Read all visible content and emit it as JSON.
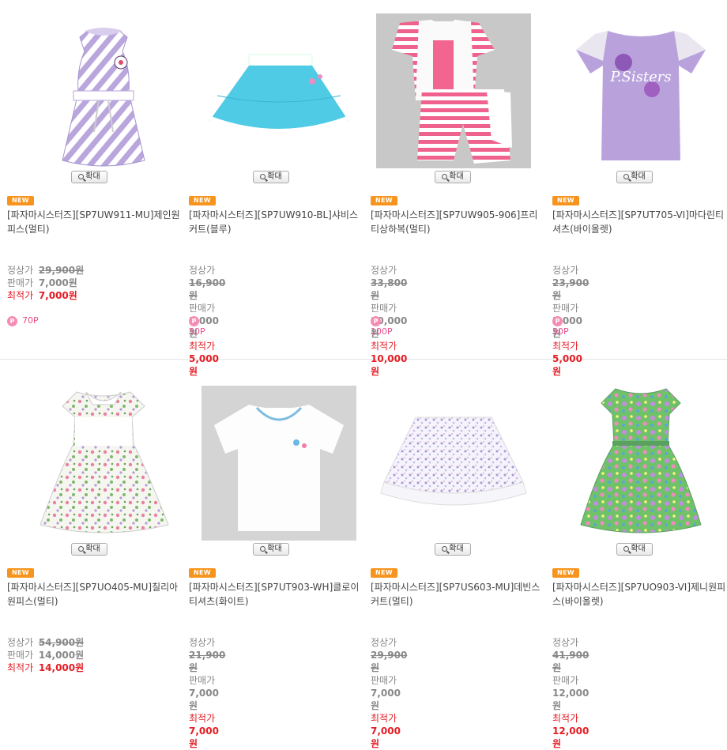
{
  "zoom_label": "확대",
  "new_label": "NEW",
  "price_labels": {
    "original": "정상가",
    "sale": "판매가",
    "best": "최적가"
  },
  "colors": {
    "best_price": "#e41c24",
    "point": "#e84c8b",
    "new_badge": "#f7941d"
  },
  "products": [
    {
      "name": "[파자마시스터즈][SP7UW911-MU]제인원피스(멀티)",
      "original": "29,900원",
      "sale": "7,000원",
      "best": "7,000원",
      "points": "70P",
      "image": "purple-striped-dress"
    },
    {
      "name": "[파자마시스터즈][SP7UW910-BL]샤비스커트(블루)",
      "original": "16,900원",
      "sale": "5,000원",
      "best": "5,000원",
      "points": "50P",
      "image": "blue-skirt"
    },
    {
      "name": "[파자마시스터즈][SP7UW905-906]프리티상하복(멀티)",
      "original": "33,800원",
      "sale": "10,000원",
      "best": "10,000원",
      "points": "100P",
      "image": "pink-striped-set"
    },
    {
      "name": "[파자마시스터즈][SP7UT705-VI]마다린티셔츠(바이올렛)",
      "original": "23,900원",
      "sale": "5,000원",
      "best": "5,000원",
      "points": "50P",
      "image": "violet-tshirt"
    },
    {
      "name": "[파자마시스터즈][SP7UO405-MU]칠리아원피스(멀티)",
      "original": "54,900원",
      "sale": "14,000원",
      "best": "14,000원",
      "points": "",
      "image": "floral-dress"
    },
    {
      "name": "[파자마시스터즈][SP7UT903-WH]클로이티셔츠(화이트)",
      "original": "21,900원",
      "sale": "7,000원",
      "best": "7,000원",
      "points": "",
      "image": "white-tshirt"
    },
    {
      "name": "[파자마시스터즈][SP7US603-MU]데빈스커트(멀티)",
      "original": "29,900원",
      "sale": "7,000원",
      "best": "7,000원",
      "points": "",
      "image": "floral-skirt"
    },
    {
      "name": "[파자마시스터즈][SP7UO903-VI]제니원피스(바이올렛)",
      "original": "41,900원",
      "sale": "12,000원",
      "best": "12,000원",
      "points": "",
      "image": "green-floral-dress"
    }
  ]
}
